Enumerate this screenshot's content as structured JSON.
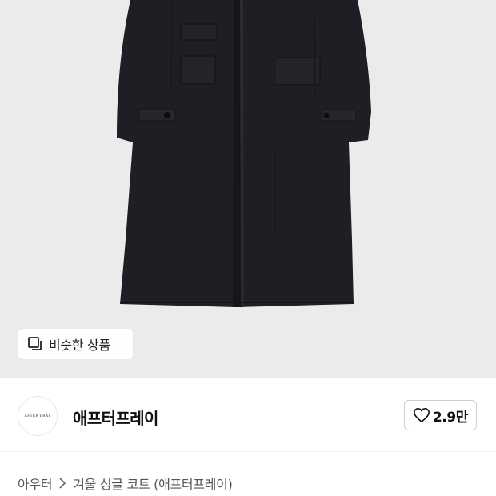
{
  "product_image": {
    "alt_icon": "coat-photo",
    "similar_button": {
      "label": "비슷한 상품",
      "icon": "similar-products-icon"
    }
  },
  "brand": {
    "logo_text": "AFTER PRAY",
    "name": "애프터프레이"
  },
  "like": {
    "icon": "heart-outline-icon",
    "count": "2.9만"
  },
  "breadcrumb": {
    "category": "아우터",
    "separator_icon": "chevron-right-icon",
    "title": "겨울 싱글 코트 (애프터프레이)"
  },
  "colors": {
    "background_gray": "#ebebeb",
    "coat": "#1e1f24"
  }
}
